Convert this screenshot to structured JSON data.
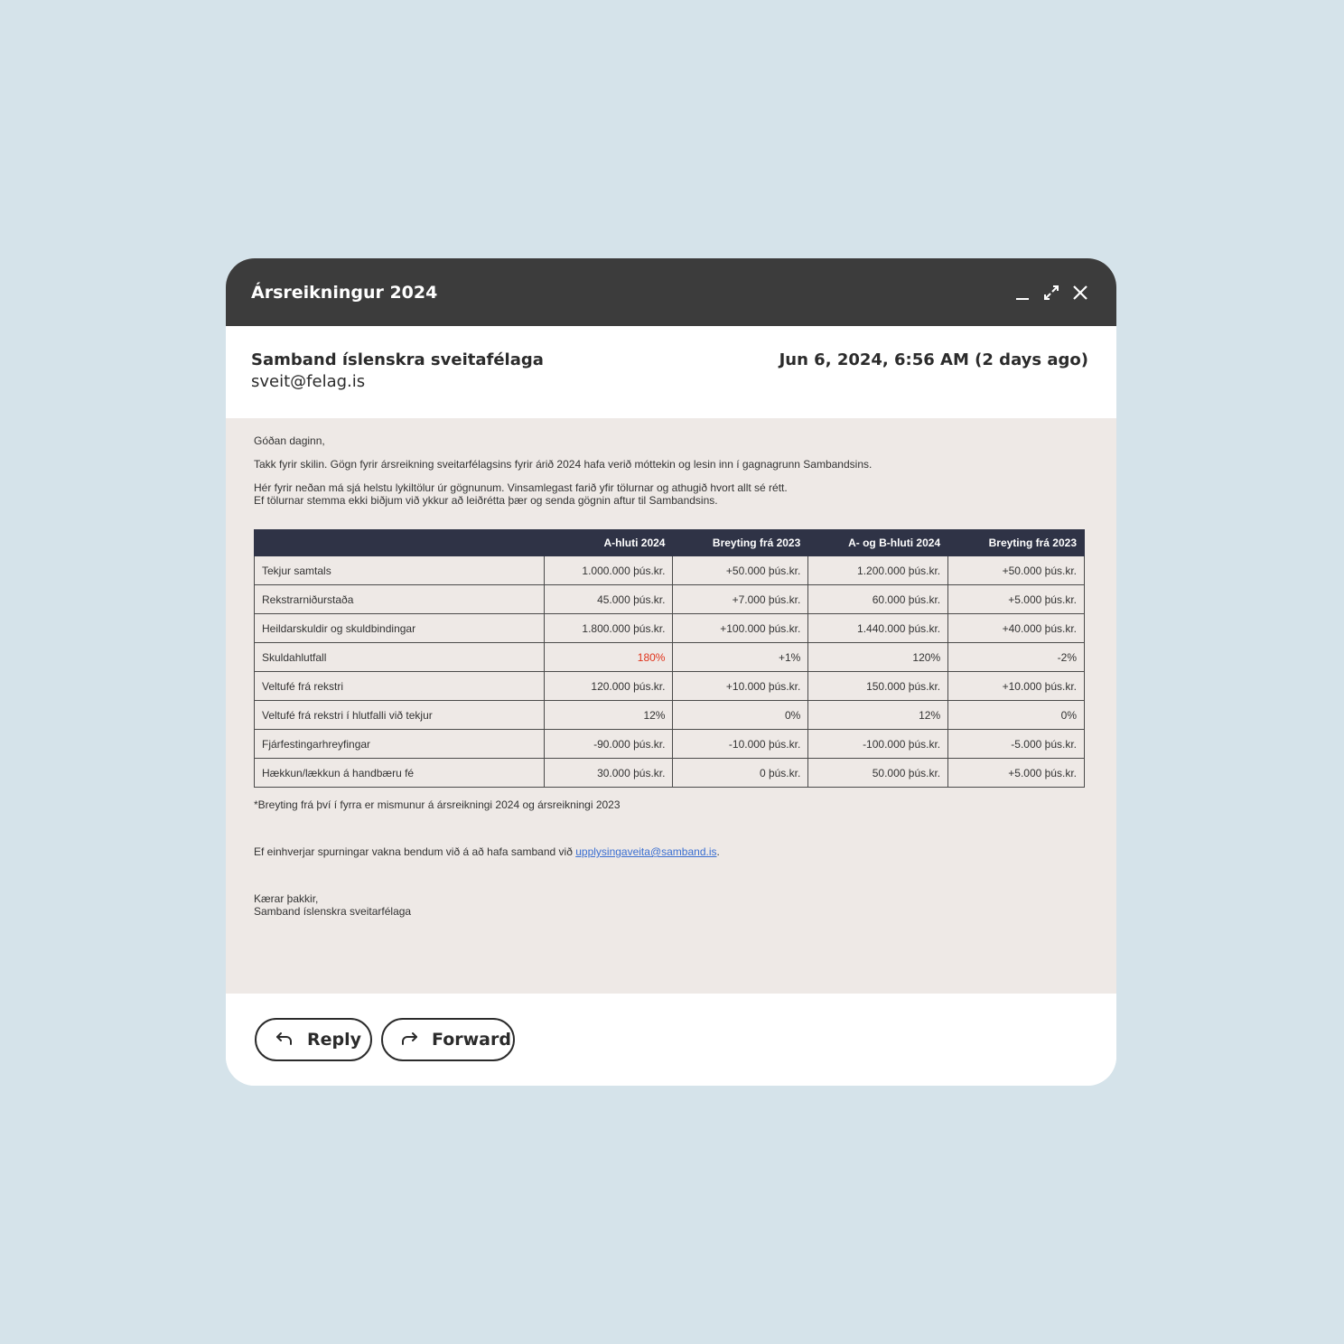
{
  "window": {
    "title": "Ársreikningur 2024"
  },
  "email": {
    "sender_name": "Samband íslenskra sveitafélaga",
    "sender_email": "sveit@felag.is",
    "date": "Jun 6, 2024, 6:56 AM (2 days ago)",
    "greeting": "Góðan daginn,",
    "para1": "Takk fyrir skilin. Gögn fyrir ársreikning sveitarfélagsins fyrir árið 2024 hafa verið móttekin og lesin inn í gagnagrunn Sambandsins.",
    "para2_line1": "Hér fyrir neðan má sjá helstu lykiltölur úr gögnunum. Vinsamlegast farið yfir tölurnar og athugið hvort allt sé rétt.",
    "para2_line2": "Ef tölurnar stemma ekki biðjum við ykkur að leiðrétta þær og senda gögnin aftur til Sambandsins.",
    "footnote": "*Breyting frá því í fyrra er mismunur á ársreikningi 2024 og ársreikningi 2023",
    "contact_text": "Ef einhverjar spurningar vakna bendum við á að hafa samband við ",
    "contact_link": "upplysingaveita@samband.is",
    "contact_end": ".",
    "signoff": "Kærar þakkir,",
    "signature": "Samband íslenskra sveitarfélaga"
  },
  "table": {
    "headers": [
      "",
      "A-hluti 2024",
      "Breyting frá 2023",
      "A- og B-hluti 2024",
      "Breyting frá 2023"
    ],
    "rows": [
      [
        "Tekjur samtals",
        "1.000.000 þús.kr.",
        "+50.000 þús.kr.",
        "1.200.000 þús.kr.",
        "+50.000 þús.kr."
      ],
      [
        "Rekstrarniðurstaða",
        "45.000 þús.kr.",
        "+7.000 þús.kr.",
        "60.000 þús.kr.",
        "+5.000 þús.kr."
      ],
      [
        "Heildarskuldir og skuldbindingar",
        "1.800.000 þús.kr.",
        "+100.000 þús.kr.",
        "1.440.000 þús.kr.",
        "+40.000 þús.kr."
      ],
      [
        "Skuldahlutfall",
        "180%",
        "+1%",
        "120%",
        "-2%"
      ],
      [
        "Veltufé frá rekstri",
        "120.000 þús.kr.",
        "+10.000 þús.kr.",
        "150.000 þús.kr.",
        "+10.000 þús.kr."
      ],
      [
        "Veltufé frá rekstri í hlutfalli við tekjur",
        "12%",
        "0%",
        "12%",
        "0%"
      ],
      [
        "Fjárfestingarhreyfingar",
        "-90.000 þús.kr.",
        "-10.000 þús.kr.",
        "-100.000 þús.kr.",
        "-5.000 þús.kr."
      ],
      [
        "Hækkun/lækkun á handbæru fé",
        "30.000 þús.kr.",
        "0 þús.kr.",
        "50.000 þús.kr.",
        "+5.000 þús.kr."
      ]
    ],
    "highlight_color": "#e0341c"
  },
  "actions": {
    "reply": "Reply",
    "forward": "Forward"
  },
  "icons": [
    "minimize-icon",
    "expand-icon",
    "close-icon",
    "reply-icon",
    "forward-icon"
  ]
}
